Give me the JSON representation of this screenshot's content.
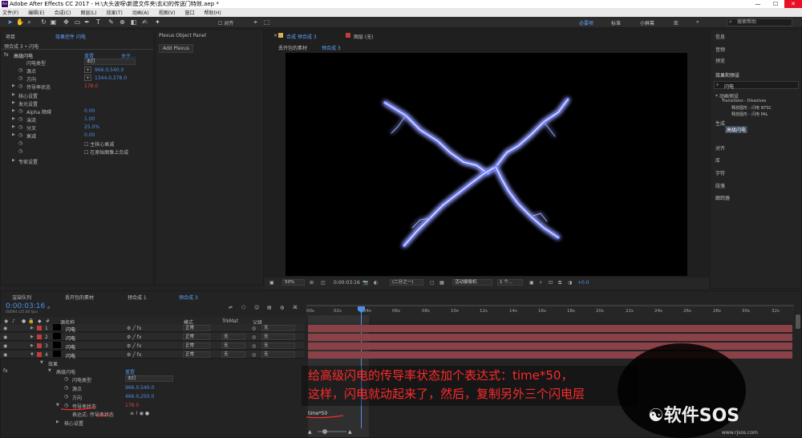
{
  "app": {
    "title": "Adobe After Effects CC 2017 - H:\\大头波呀\\新建文件夹\\玄幻的传送门特效.aep *",
    "icon_label": "Ae"
  },
  "menu": [
    "文件(F)",
    "编辑(E)",
    "合成(C)",
    "图层(L)",
    "效果(T)",
    "动画(A)",
    "视图(V)",
    "窗口",
    "帮助(H)"
  ],
  "toolbar": {
    "snap_label": "对齐",
    "workspaces": [
      "必要项",
      "标准",
      "小屏幕",
      "库"
    ],
    "search_placeholder": "搜索帮助"
  },
  "effect_controls": {
    "tab_project": "项目",
    "tab_label": "效果控件 闪电",
    "breadcrumb": "预合成 3 • 闪电",
    "effect_name": "高级闪电",
    "reset": "重置",
    "about": "关于...",
    "props": [
      {
        "label": "闪电类型",
        "value": "击打"
      },
      {
        "label": "源点",
        "value": "966.0,540.0"
      },
      {
        "label": "方向",
        "value": "1344.0,378.0"
      },
      {
        "label": "传导率状态",
        "value": "178.0"
      },
      {
        "label": "核心设置",
        "value": ""
      },
      {
        "label": "发光设置",
        "value": ""
      },
      {
        "label": "Alpha 障碍",
        "value": "0.00"
      },
      {
        "label": "湍流",
        "value": "1.00"
      },
      {
        "label": "分叉",
        "value": "25.0%"
      },
      {
        "label": "衰减",
        "value": "0.00"
      },
      {
        "label": "",
        "value": "主核心衰减"
      },
      {
        "label": "",
        "value": "在原始图像上合成"
      },
      {
        "label": "专家设置",
        "value": ""
      }
    ]
  },
  "plexus": {
    "tab": "Plexus Object Panel",
    "button": "Add Plexus"
  },
  "composition": {
    "tab_comp": "合成 预合成 3",
    "tab_layer": "图层 (无)",
    "breadcrumbs": [
      "丢开包的素材",
      "预合成 3"
    ],
    "zoom": "50%",
    "timecode": "0:00:03:16",
    "resolution": "(二分之一)",
    "camera": "活动摄像机",
    "views": "1 个...",
    "exposure": "+0.0"
  },
  "right_panel": {
    "items": [
      "信息",
      "音频",
      "预览",
      "效果和预设"
    ],
    "search_value": "闪电",
    "tree": [
      "* 动画预设",
      "Transitions - Dissolves",
      "释放图形 - 闪电 NTSC",
      "释放图形 - 闪电 PAL",
      "生成",
      "高级闪电"
    ],
    "items2": [
      "对齐",
      "库",
      "字符",
      "段落",
      "跟踪器"
    ]
  },
  "timeline": {
    "tabs": [
      "渲染队列",
      "丢开包的素材",
      "预合成 1",
      "预合成 3"
    ],
    "current_time": "0:00:03:16",
    "fps_info": "00094 (25.00 fps)",
    "col_source": "源名称",
    "col_mode": "模式",
    "col_trkmat": "TrkMat",
    "col_parent": "父级",
    "ruler": [
      "00s",
      "02s",
      "04s",
      "06s",
      "08s",
      "10s",
      "12s",
      "14s",
      "16s",
      "18s",
      "20s",
      "22s",
      "24s",
      "26s",
      "28s",
      "30s",
      "32s"
    ],
    "layers": [
      {
        "num": "1",
        "name": "闪电",
        "mode": "正常",
        "trk": "",
        "parent": "无"
      },
      {
        "num": "2",
        "name": "闪电",
        "mode": "正常",
        "trk": "无",
        "parent": "无"
      },
      {
        "num": "3",
        "name": "闪电",
        "mode": "正常",
        "trk": "无",
        "parent": "无"
      },
      {
        "num": "4",
        "name": "闪电",
        "mode": "正常",
        "trk": "无",
        "parent": "无"
      }
    ],
    "sub": {
      "effects": "效果",
      "effect": "高级闪电",
      "reset": "重置",
      "type_label": "闪电类型",
      "type_value": "击打",
      "origin_label": "源点",
      "origin_value": "966.0,540.0",
      "dir_label": "方向",
      "dir_value": "466.0,250.0",
      "cond_label": "传导率状态",
      "cond_value": "178.0",
      "expr_label": "表达式: 传导率状态",
      "core_label": "核心设置",
      "expression_text": "time*50"
    }
  },
  "annotation": {
    "line1": "给高级闪电的传导率状态加个表达式：time*50，",
    "line2": "这样，闪电就动起来了，然后，复制另外三个闪电层"
  },
  "watermark": {
    "text": "软件SOS",
    "url": "www.rjsos.com"
  },
  "colors": {
    "accent": "#5ea3ff",
    "layer_bar": "#8a4147",
    "annotation": "#ff2a2a",
    "lightning": "#8f9bff"
  }
}
